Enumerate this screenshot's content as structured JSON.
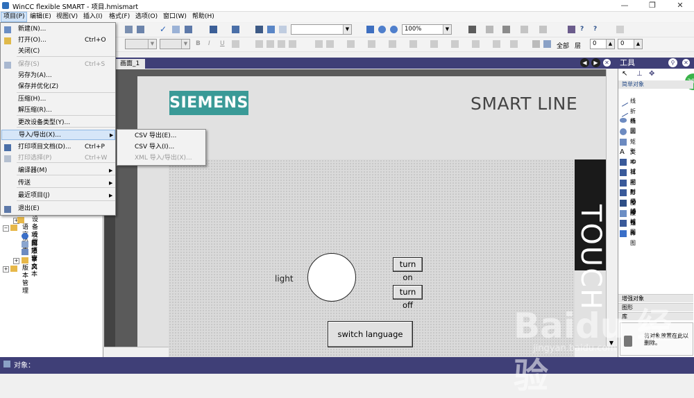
{
  "window": {
    "title": "WinCC flexible SMART - 项目.hmismart",
    "minimize": "—",
    "restore": "❐",
    "close": "✕"
  },
  "menubar": [
    "项目(P)",
    "编辑(E)",
    "视图(V)",
    "插入(I)",
    "格式(F)",
    "选项(O)",
    "窗口(W)",
    "帮助(H)"
  ],
  "toolbar": {
    "zoom": "100%",
    "all_label": "全部",
    "layer_label": "层",
    "layer_value": "0",
    "spin_value": "0"
  },
  "project_menu": {
    "items": [
      {
        "label": "新建(N)...",
        "shortcut": "",
        "disabled": false
      },
      {
        "label": "打开(O)...",
        "shortcut": "Ctrl+O",
        "disabled": false
      },
      {
        "label": "关闭(C)",
        "shortcut": "",
        "disabled": false
      },
      {
        "label": "保存(S)",
        "shortcut": "Ctrl+S",
        "disabled": true
      },
      {
        "label": "另存为(A)...",
        "shortcut": "",
        "disabled": false
      },
      {
        "label": "保存并优化(Z)",
        "shortcut": "",
        "disabled": false
      },
      {
        "label": "压缩(H)...",
        "shortcut": "",
        "disabled": false
      },
      {
        "label": "解压缩(R)...",
        "shortcut": "",
        "disabled": false
      },
      {
        "label": "更改设备类型(Y)...",
        "shortcut": "",
        "disabled": false
      },
      {
        "label": "导入/导出(X)...",
        "shortcut": "",
        "disabled": false,
        "highlighted": true
      },
      {
        "label": "打印项目文档(D)...",
        "shortcut": "Ctrl+P",
        "disabled": false
      },
      {
        "label": "打印选择(P)",
        "shortcut": "Ctrl+W",
        "disabled": true
      },
      {
        "label": "编译器(M)",
        "shortcut": "",
        "disabled": false
      },
      {
        "label": "传送",
        "shortcut": "",
        "disabled": false
      },
      {
        "label": "最近项目(J)",
        "shortcut": "",
        "disabled": false
      },
      {
        "label": "退出(E)",
        "shortcut": "",
        "disabled": false
      }
    ]
  },
  "submenu": {
    "items": [
      {
        "label": "CSV 导出(E)...",
        "disabled": false
      },
      {
        "label": "CSV 导入(I)...",
        "disabled": false
      },
      {
        "label": "XML 导入/导出(X)...",
        "disabled": true
      }
    ]
  },
  "project_tree": {
    "items": [
      {
        "label": "设备设置",
        "indent": 2
      },
      {
        "label": "语言设置",
        "indent": 1
      },
      {
        "label": "项目语言",
        "indent": 2
      },
      {
        "label": "图形",
        "indent": 2
      },
      {
        "label": "项目文本",
        "indent": 2
      },
      {
        "label": "字典",
        "indent": 2
      },
      {
        "label": "版本管理",
        "indent": 1
      }
    ]
  },
  "editor": {
    "tab": "画面_1",
    "logo": "SIEMENS",
    "brand": "SMART LINE",
    "touch": "TOUCH",
    "light_label": "light",
    "btn_on": "turn on",
    "btn_off": "turn off",
    "btn_lang": "switch language"
  },
  "tools": {
    "title": "工具",
    "section": "简单对象",
    "items": [
      "线",
      "折线",
      "椭圆",
      "圆",
      "矩形",
      "文本域",
      "IO 域",
      "日期时间域",
      "图形 IO 域",
      "符号 IO 域",
      "图形视图",
      "按钮",
      "开关",
      "棒图"
    ],
    "categories": [
      "增强对象",
      "图形",
      "库"
    ],
    "badge": "39",
    "tooltip": "将对象放置在此以删除。"
  },
  "status": {
    "label": "对象："
  },
  "watermark": {
    "main": "Baidu 经验",
    "url": "jingyan.baidu.com"
  }
}
